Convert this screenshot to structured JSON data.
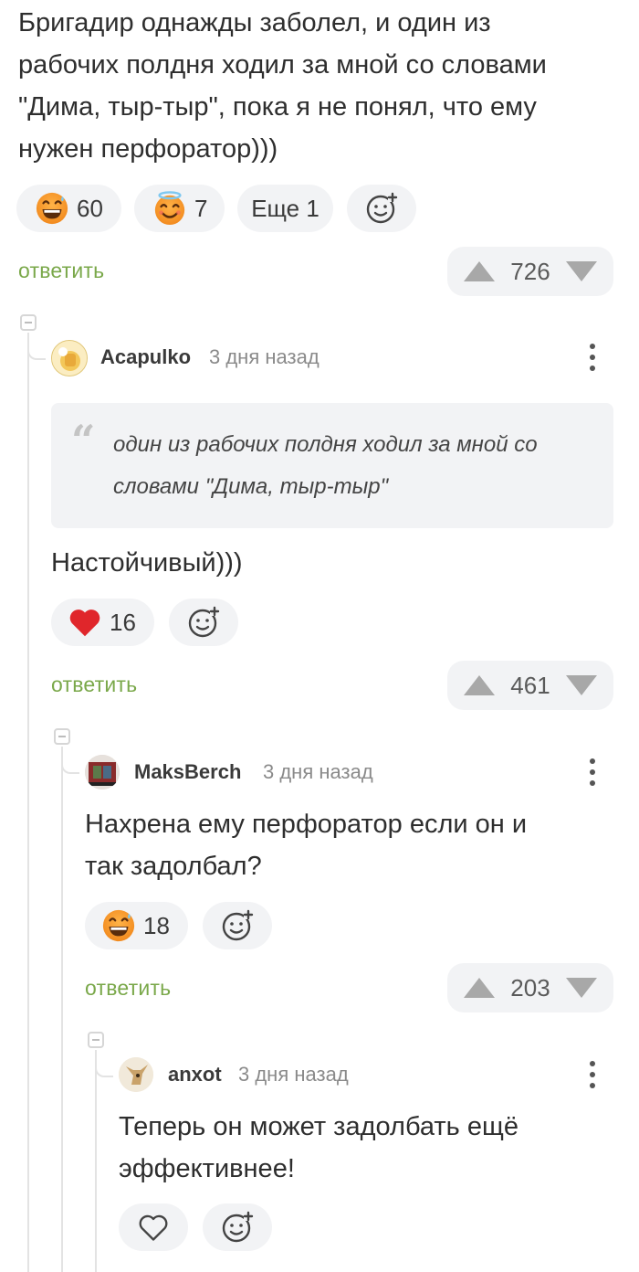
{
  "post": {
    "text_lines": [
      "Бригадир однажды заболел, и один из",
      "рабочих полдня ходил за мной со словами",
      "\"Дима, тыр-тыр\", пока я не понял, что ему",
      "нужен перфоратор)))"
    ],
    "reactions": [
      {
        "icon": "grinning-sweat-emoji-icon",
        "count": "60"
      },
      {
        "icon": "halo-smile-emoji-icon",
        "count": "7"
      }
    ],
    "more_reactions_label": "Еще 1",
    "reply_label": "ответить",
    "rating": "726"
  },
  "comments": [
    {
      "author": "Acapulko",
      "time": "3 дня назад",
      "quote_lines": [
        "один из рабочих полдня ходил за мной со",
        "словами \"Дима, тыр-тыр\""
      ],
      "text_lines": [
        "Настойчивый)))"
      ],
      "reaction_icon": "heart-icon",
      "reaction_count": "16",
      "reply_label": "ответить",
      "rating": "461"
    },
    {
      "author": "MaksBerch",
      "time": "3 дня назад",
      "text_lines": [
        "Нахрена ему перфоратор если он и",
        "так задолбал?"
      ],
      "reaction_icon": "grinning-sweat-emoji-icon",
      "reaction_count": "18",
      "reply_label": "ответить",
      "rating": "203"
    },
    {
      "author": "anxot",
      "time": "3 дня назад",
      "text_lines": [
        "Теперь он может задолбать ещё",
        "эффективнее!"
      ],
      "reaction_icon": "heart-outline-icon"
    }
  ],
  "colors": {
    "reply_green": "#7aa84a",
    "pill_bg": "#f2f3f5",
    "heart_red": "#e0262b",
    "emoji_orange": "#f59b30"
  }
}
